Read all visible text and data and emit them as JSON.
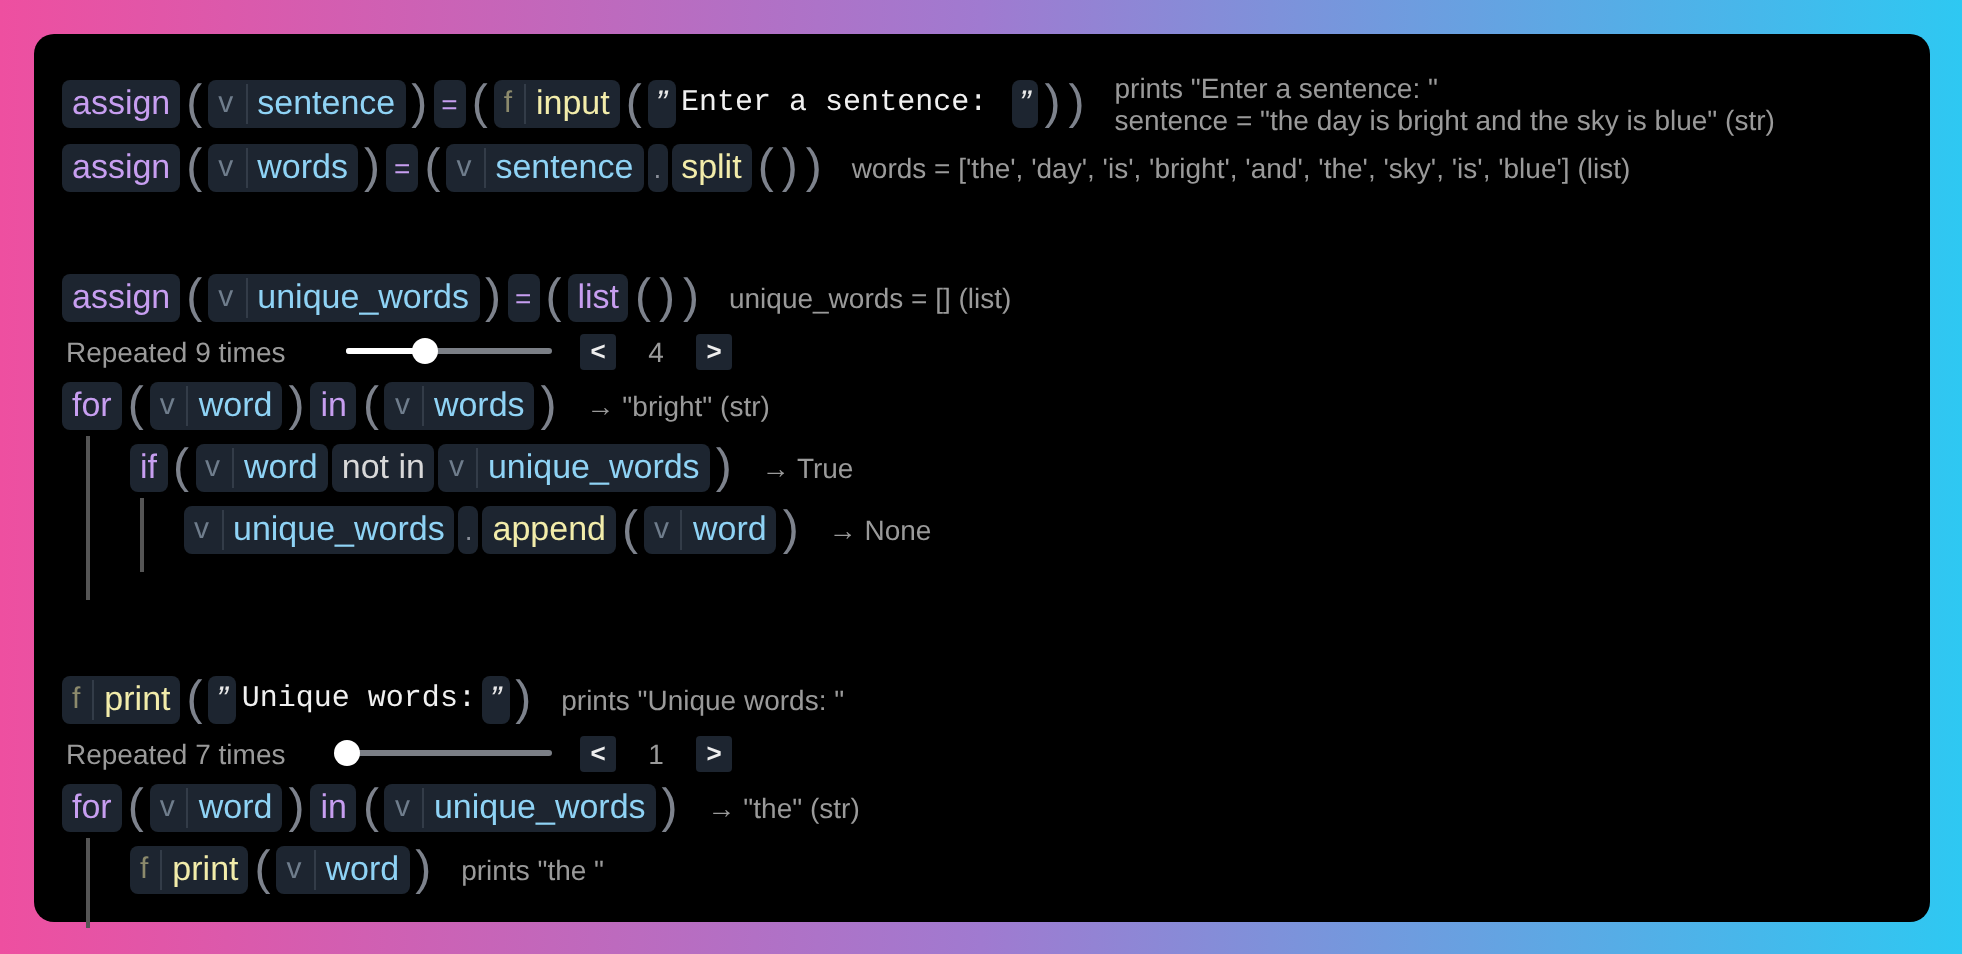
{
  "groups": [
    {
      "items": [
        {
          "kind": "line",
          "tokens": [
            {
              "kind": "kw",
              "text": "assign"
            },
            {
              "kind": "paren",
              "text": "("
            },
            {
              "kind": "var",
              "tag": "v",
              "text": "sentence"
            },
            {
              "kind": "paren",
              "text": ")"
            },
            {
              "kind": "sym",
              "text": "="
            },
            {
              "kind": "paren",
              "text": "("
            },
            {
              "kind": "func",
              "tag": "f",
              "text": "input"
            },
            {
              "kind": "paren",
              "text": "("
            },
            {
              "kind": "str",
              "open": "”",
              "text": "Enter a sentence: ",
              "close": "”"
            },
            {
              "kind": "paren",
              "text": ")"
            },
            {
              "kind": "paren",
              "text": ")"
            }
          ],
          "notes": [
            "prints \"Enter a sentence: \"",
            "sentence = \"the day is bright and the sky is blue\" (str)"
          ]
        },
        {
          "kind": "line",
          "tokens": [
            {
              "kind": "kw",
              "text": "assign"
            },
            {
              "kind": "paren",
              "text": "("
            },
            {
              "kind": "var",
              "tag": "v",
              "text": "words"
            },
            {
              "kind": "paren",
              "text": ")"
            },
            {
              "kind": "sym",
              "text": "="
            },
            {
              "kind": "paren",
              "text": "("
            },
            {
              "kind": "var",
              "tag": "v",
              "text": "sentence"
            },
            {
              "kind": "dot",
              "text": "."
            },
            {
              "kind": "method",
              "text": "split"
            },
            {
              "kind": "paren",
              "text": "("
            },
            {
              "kind": "paren",
              "text": ")"
            },
            {
              "kind": "paren",
              "text": ")"
            }
          ],
          "notes": [
            "words = ['the', 'day', 'is', 'bright', 'and', 'the', 'sky', 'is', 'blue'] (list)"
          ]
        }
      ]
    },
    {
      "items": [
        {
          "kind": "line",
          "tokens": [
            {
              "kind": "kw",
              "text": "assign"
            },
            {
              "kind": "paren",
              "text": "("
            },
            {
              "kind": "var",
              "tag": "v",
              "text": "unique_words"
            },
            {
              "kind": "paren",
              "text": ")"
            },
            {
              "kind": "sym",
              "text": "="
            },
            {
              "kind": "paren",
              "text": "("
            },
            {
              "kind": "kw",
              "text": "list"
            },
            {
              "kind": "paren",
              "text": "("
            },
            {
              "kind": "paren",
              "text": ")"
            },
            {
              "kind": "paren",
              "text": ")"
            }
          ],
          "notes": [
            "unique_words = [] (list)"
          ]
        },
        {
          "kind": "repeat",
          "label": "Repeated 9 times",
          "level": 0.38,
          "prev": "<",
          "value": "4",
          "next": ">"
        },
        {
          "kind": "block",
          "tokens": [
            {
              "kind": "kw",
              "text": "for"
            },
            {
              "kind": "paren",
              "text": "("
            },
            {
              "kind": "var",
              "tag": "v",
              "text": "word"
            },
            {
              "kind": "paren",
              "text": ")"
            },
            {
              "kind": "kw",
              "text": "in"
            },
            {
              "kind": "paren",
              "text": "("
            },
            {
              "kind": "var",
              "tag": "v",
              "text": "words"
            },
            {
              "kind": "paren",
              "text": ")"
            }
          ],
          "notes": [
            "→ \"bright\" (str)"
          ],
          "children": [
            {
              "kind": "block",
              "tokens": [
                {
                  "kind": "kw",
                  "text": "if"
                },
                {
                  "kind": "paren",
                  "text": "("
                },
                {
                  "kind": "var",
                  "tag": "v",
                  "text": "word"
                },
                {
                  "kind": "op",
                  "text": "not in"
                },
                {
                  "kind": "var",
                  "tag": "v",
                  "text": "unique_words"
                },
                {
                  "kind": "paren",
                  "text": ")"
                }
              ],
              "notes": [
                "→ True"
              ],
              "children": [
                {
                  "kind": "line",
                  "tokens": [
                    {
                      "kind": "var",
                      "tag": "v",
                      "text": "unique_words"
                    },
                    {
                      "kind": "dot",
                      "text": "."
                    },
                    {
                      "kind": "method",
                      "text": "append"
                    },
                    {
                      "kind": "paren",
                      "text": "("
                    },
                    {
                      "kind": "var",
                      "tag": "v",
                      "text": "word"
                    },
                    {
                      "kind": "paren",
                      "text": ")"
                    }
                  ],
                  "notes": [
                    "→ None"
                  ]
                }
              ]
            }
          ]
        }
      ]
    },
    {
      "items": [
        {
          "kind": "line",
          "tokens": [
            {
              "kind": "func",
              "tag": "f",
              "text": "print"
            },
            {
              "kind": "paren",
              "text": "("
            },
            {
              "kind": "str",
              "open": "”",
              "text": "Unique words:",
              "close": "”"
            },
            {
              "kind": "paren",
              "text": ")"
            }
          ],
          "notes": [
            "prints \"Unique words: \""
          ]
        },
        {
          "kind": "repeat",
          "label": "Repeated 7 times",
          "level": 0,
          "prev": "<",
          "value": "1",
          "next": ">"
        },
        {
          "kind": "block",
          "tokens": [
            {
              "kind": "kw",
              "text": "for"
            },
            {
              "kind": "paren",
              "text": "("
            },
            {
              "kind": "var",
              "tag": "v",
              "text": "word"
            },
            {
              "kind": "paren",
              "text": ")"
            },
            {
              "kind": "kw",
              "text": "in"
            },
            {
              "kind": "paren",
              "text": "("
            },
            {
              "kind": "var",
              "tag": "v",
              "text": "unique_words"
            },
            {
              "kind": "paren",
              "text": ")"
            }
          ],
          "notes": [
            "→ \"the\" (str)"
          ],
          "children": [
            {
              "kind": "line",
              "tokens": [
                {
                  "kind": "func",
                  "tag": "f",
                  "text": "print"
                },
                {
                  "kind": "paren",
                  "text": "("
                },
                {
                  "kind": "var",
                  "tag": "v",
                  "text": "word"
                },
                {
                  "kind": "paren",
                  "text": ")"
                }
              ],
              "notes": [
                "prints \"the \""
              ]
            }
          ]
        }
      ]
    }
  ]
}
